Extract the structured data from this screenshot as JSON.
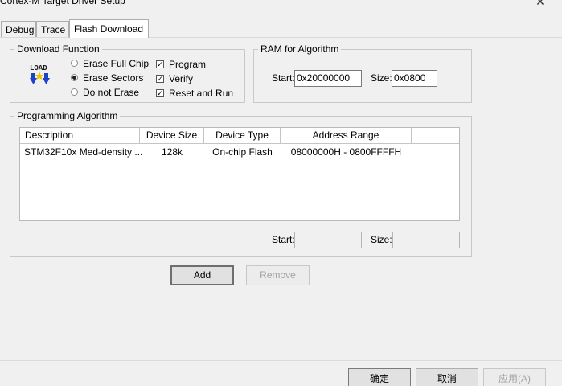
{
  "window": {
    "title": "Cortex-M Target Driver Setup",
    "close_glyph": "✕"
  },
  "tabs": [
    {
      "label": "Debug",
      "active": false
    },
    {
      "label": "Trace",
      "active": false
    },
    {
      "label": "Flash Download",
      "active": true
    }
  ],
  "download_function": {
    "legend": "Download Function",
    "icon_text": "LOAD",
    "radios": [
      {
        "label": "Erase Full Chip",
        "checked": false
      },
      {
        "label": "Erase Sectors",
        "checked": true
      },
      {
        "label": "Do not Erase",
        "checked": false
      }
    ],
    "checkboxes": [
      {
        "label": "Program",
        "checked": true
      },
      {
        "label": "Verify",
        "checked": true
      },
      {
        "label": "Reset and Run",
        "checked": true
      }
    ]
  },
  "ram_for_algorithm": {
    "legend": "RAM for Algorithm",
    "start_label": "Start:",
    "start_value": "0x20000000",
    "size_label": "Size:",
    "size_value": "0x0800"
  },
  "programming_algorithm": {
    "legend": "Programming Algorithm",
    "columns": [
      "Description",
      "Device Size",
      "Device Type",
      "Address Range"
    ],
    "rows": [
      {
        "description": "STM32F10x Med-density ...",
        "device_size": "128k",
        "device_type": "On-chip Flash",
        "address_range": "08000000H - 0800FFFFH"
      }
    ],
    "start_label": "Start:",
    "start_value": "",
    "size_label": "Size:",
    "size_value": ""
  },
  "buttons": {
    "add": "Add",
    "remove": "Remove",
    "ok": "确定",
    "cancel": "取消",
    "apply": "应用(A)"
  },
  "colors": {
    "window_bg": "#f0f0f0",
    "border": "#adadad",
    "disabled_text": "#a3a3a3",
    "icon_blue": "#1a44c8",
    "icon_yellow": "#f2c200"
  }
}
